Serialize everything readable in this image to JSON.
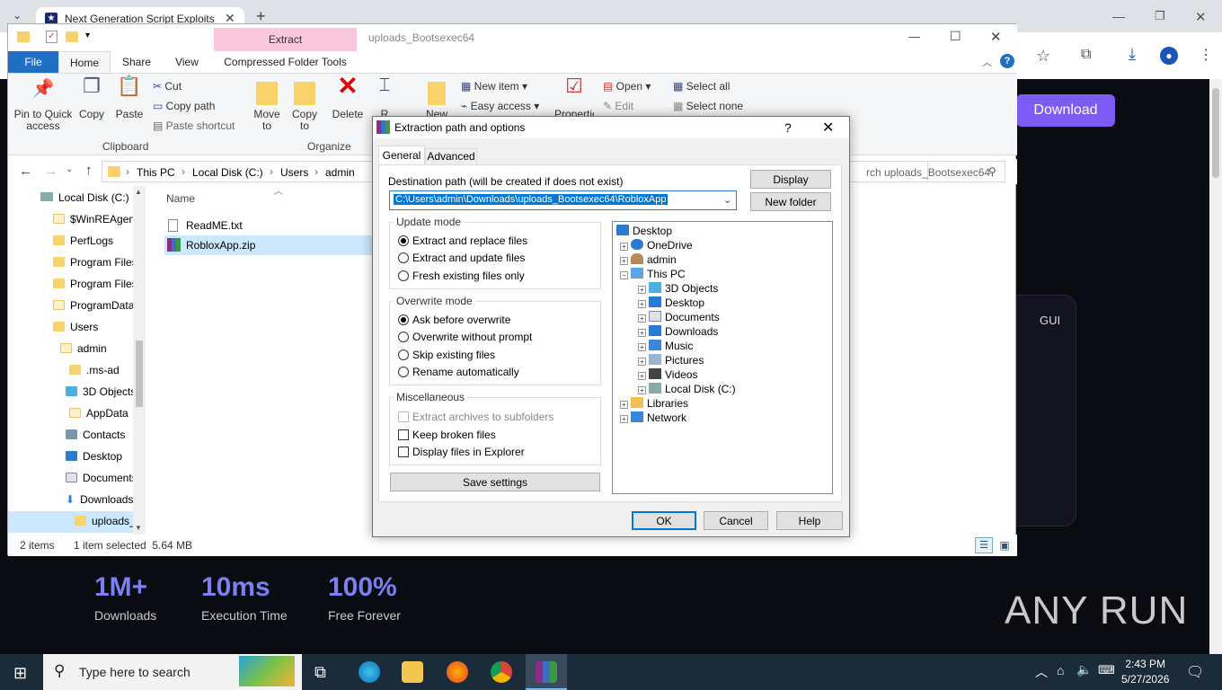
{
  "browser": {
    "tab_title": "Next Generation Script Exploits",
    "new_tab": "+"
  },
  "website": {
    "download_button": "Download",
    "gui_label": "GUI",
    "stats": [
      {
        "value": "1M+",
        "label": "Downloads"
      },
      {
        "value": "10ms",
        "label": "Execution Time"
      },
      {
        "value": "100%",
        "label": "Free Forever"
      }
    ],
    "watermark": "ANY RUN"
  },
  "explorer": {
    "window_title": "uploads_Bootsexec64",
    "context_tab_header": "Extract",
    "tabs": [
      "File",
      "Home",
      "Share",
      "View",
      "Compressed Folder Tools"
    ],
    "ribbon": {
      "pin": "Pin to Quick access",
      "copy": "Copy",
      "paste": "Paste",
      "cut": "Cut",
      "copy_path": "Copy path",
      "paste_shortcut": "Paste shortcut",
      "clipboard_group": "Clipboard",
      "move_to": "Move to",
      "copy_to": "Copy to",
      "delete": "Delete",
      "rename": "R",
      "organize_group": "Organize",
      "new_folder": "New",
      "new_item": "New item",
      "easy_access": "Easy access",
      "properties": "Properties",
      "open": "Open",
      "edit": "Edit",
      "select_all": "Select all",
      "select_none": "Select none"
    },
    "breadcrumb": [
      "This PC",
      "Local Disk (C:)",
      "Users",
      "admin"
    ],
    "search_placeholder": "rch uploads_Bootsexec64",
    "nav_items": [
      "Local Disk (C:)",
      "$WinREAgent",
      "PerfLogs",
      "Program Files",
      "Program Files",
      "ProgramData",
      "Users",
      "admin",
      ".ms-ad",
      "3D Objects",
      "AppData",
      "Contacts",
      "Desktop",
      "Documents",
      "Downloads",
      "uploads_"
    ],
    "column_name": "Name",
    "files": [
      "ReadME.txt",
      "RobloxApp.zip"
    ],
    "status_items": "2 items",
    "status_selected": "1 item selected  5.64 MB"
  },
  "dialog": {
    "title": "Extraction path and options",
    "help_char": "?",
    "tabs": [
      "General",
      "Advanced"
    ],
    "dest_label": "Destination path (will be created if does not exist)",
    "dest_value": "C:\\Users\\admin\\Downloads\\uploads_Bootsexec64\\RobloxApp",
    "display_btn": "Display",
    "new_folder_btn": "New folder",
    "update_mode": {
      "label": "Update mode",
      "options": [
        "Extract and replace files",
        "Extract and update files",
        "Fresh existing files only"
      ],
      "selected": 0
    },
    "overwrite_mode": {
      "label": "Overwrite mode",
      "options": [
        "Ask before overwrite",
        "Overwrite without prompt",
        "Skip existing files",
        "Rename automatically"
      ],
      "selected": 0
    },
    "misc": {
      "label": "Miscellaneous",
      "options": [
        "Extract archives to subfolders",
        "Keep broken files",
        "Display files in Explorer"
      ]
    },
    "save_settings": "Save settings",
    "tree": [
      "Desktop",
      "OneDrive",
      "admin",
      "This PC",
      "3D Objects",
      "Desktop",
      "Documents",
      "Downloads",
      "Music",
      "Pictures",
      "Videos",
      "Local Disk (C:)",
      "Libraries",
      "Network"
    ],
    "ok": "OK",
    "cancel": "Cancel",
    "help": "Help"
  },
  "taskbar": {
    "search_placeholder": "Type here to search",
    "time": "2:43 PM",
    "date": "5/27/2026"
  }
}
